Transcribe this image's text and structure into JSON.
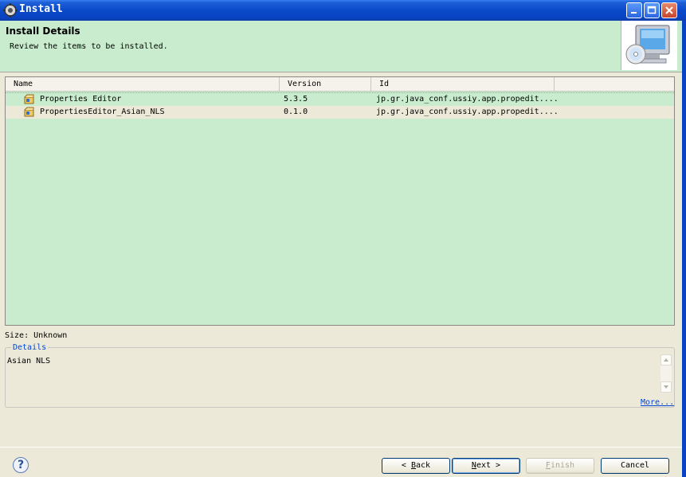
{
  "window": {
    "title": "Install"
  },
  "header": {
    "title": "Install Details",
    "subtitle": "Review the items to be installed."
  },
  "table": {
    "columns": [
      "Name",
      "Version",
      "Id"
    ],
    "rows": [
      {
        "name": "Properties Editor",
        "version": "5.3.5",
        "id": "jp.gr.java_conf.ussiy.app.propedit...."
      },
      {
        "name": "PropertiesEditor_Asian_NLS",
        "version": "0.1.0",
        "id": "jp.gr.java_conf.ussiy.app.propedit...."
      }
    ]
  },
  "size_label": "Size: Unknown",
  "details": {
    "legend": "Details",
    "text": "Asian NLS",
    "more_link": "More..."
  },
  "buttons": {
    "help": "?",
    "back": {
      "arrow": "< ",
      "mnemonic": "B",
      "rest": "ack"
    },
    "next": {
      "mnemonic": "N",
      "rest": "ext",
      "arrow": " >"
    },
    "finish": {
      "mnemonic": "F",
      "rest": "inish"
    },
    "cancel": "Cancel"
  },
  "icons": {
    "window": "gear-icon",
    "banner": "install-cd-icon",
    "row": "feature-package-icon"
  }
}
